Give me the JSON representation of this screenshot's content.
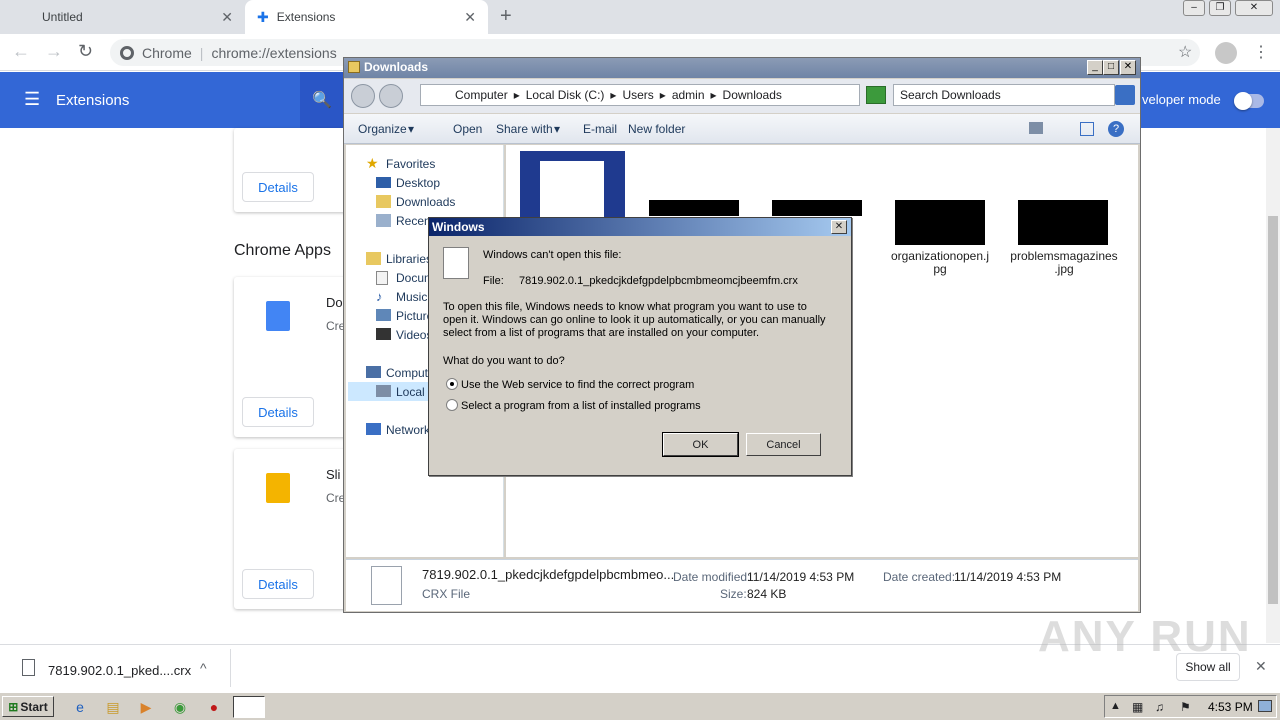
{
  "browser": {
    "tabs": [
      {
        "label": "Untitled"
      },
      {
        "label": "Extensions"
      }
    ],
    "omnibox": {
      "site": "Chrome",
      "url": "chrome://extensions"
    }
  },
  "extensions_page": {
    "title": "Extensions",
    "developer_mode_label": "veloper mode",
    "section_label": "Chrome Apps",
    "details_label": "Details",
    "cards": [
      {
        "title": "Do",
        "desc": "Cre"
      },
      {
        "title": "Sli",
        "desc": "Cre"
      }
    ]
  },
  "explorer": {
    "title": "Downloads",
    "breadcrumb": [
      "Computer",
      "Local Disk (C:)",
      "Users",
      "admin",
      "Downloads"
    ],
    "search_placeholder": "Search Downloads",
    "commands": {
      "organize": "Organize",
      "open": "Open",
      "share_with": "Share with",
      "email": "E-mail",
      "new_folder": "New folder"
    },
    "nav": {
      "favorites": "Favorites",
      "desktop": "Desktop",
      "downloads": "Downloads",
      "recent": "Recen",
      "libraries": "Libraries",
      "documents": "Docum",
      "music": "Music",
      "pictures": "Picture",
      "videos": "Videos",
      "computer": "Compute",
      "local_disk": "Local D",
      "network": "Network"
    },
    "files": [
      {
        "name_line1": "organizationopen.j",
        "name_line2": "pg"
      },
      {
        "name_line1": "problemsmagazines",
        "name_line2": ".jpg"
      }
    ],
    "details_pane": {
      "filename": "7819.902.0.1_pkedcjkdefgpdelpbcmbmeo...",
      "type": "CRX File",
      "date_modified_label": "Date modified:",
      "date_modified": "11/14/2019 4:53 PM",
      "date_created_label": "Date created:",
      "date_created": "11/14/2019 4:53 PM",
      "size_label": "Size:",
      "size": "824 KB"
    }
  },
  "dialog": {
    "title": "Windows",
    "heading": "Windows can't open this file:",
    "file_label": "File:",
    "file_name": "7819.902.0.1_pkedcjkdefgpdelpbcmbmeomcjbeemfm.crx",
    "explain_line1": "To open this file, Windows needs to know what program you want to use to",
    "explain_line2": "open it. Windows can go online to look it up automatically, or you can manually",
    "explain_line3": "select from a list of programs that are installed on your computer.",
    "question": "What do you want to do?",
    "option_web": "Use the Web service to find the correct program",
    "option_list": "Select a program from a list of installed programs",
    "ok": "OK",
    "cancel": "Cancel"
  },
  "download_bar": {
    "item_label": "7819.902.0.1_pked....crx",
    "show_all": "Show all"
  },
  "taskbar": {
    "start": "Start",
    "clock": "4:53 PM"
  },
  "watermark": "ANY RUN"
}
